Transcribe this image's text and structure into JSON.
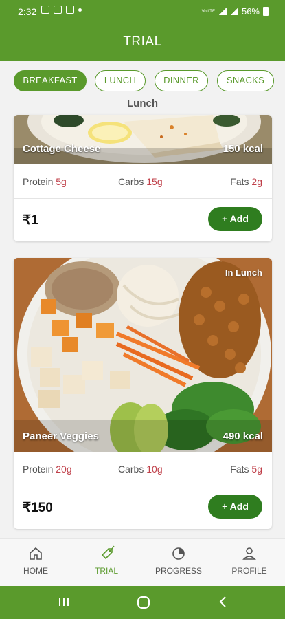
{
  "status_bar": {
    "time": "2:32",
    "network": "Vo LTE",
    "battery": "56%"
  },
  "app_bar": {
    "title": "TRIAL"
  },
  "meal_tabs": [
    {
      "label": "BREAKFAST",
      "active": true
    },
    {
      "label": "LUNCH",
      "active": false
    },
    {
      "label": "DINNER",
      "active": false
    },
    {
      "label": "SNACKS",
      "active": false
    }
  ],
  "section_title": "Lunch",
  "meals": [
    {
      "name": "Cottage Cheese",
      "kcal": "150 kcal",
      "protein_label": "Protein",
      "protein": "5g",
      "carbs_label": "Carbs",
      "carbs": "15g",
      "fats_label": "Fats",
      "fats": "2g",
      "price": "₹1",
      "add_label": "+ Add"
    },
    {
      "name": "Paneer Veggies",
      "kcal": "490 kcal",
      "tag": "In Lunch",
      "protein_label": "Protein",
      "protein": "20g",
      "carbs_label": "Carbs",
      "carbs": "10g",
      "fats_label": "Fats",
      "fats": "5g",
      "price": "₹150",
      "add_label": "+ Add"
    }
  ],
  "bottom_nav": [
    {
      "label": "HOME",
      "icon": "home-icon",
      "active": false
    },
    {
      "label": "TRIAL",
      "icon": "trial-tag-icon",
      "active": true
    },
    {
      "label": "PROGRESS",
      "icon": "progress-icon",
      "active": false
    },
    {
      "label": "PROFILE",
      "icon": "profile-icon",
      "active": false
    }
  ],
  "colors": {
    "primary": "#5a9a2c",
    "add_button": "#2f7d1f",
    "macro_value": "#c0404a"
  }
}
